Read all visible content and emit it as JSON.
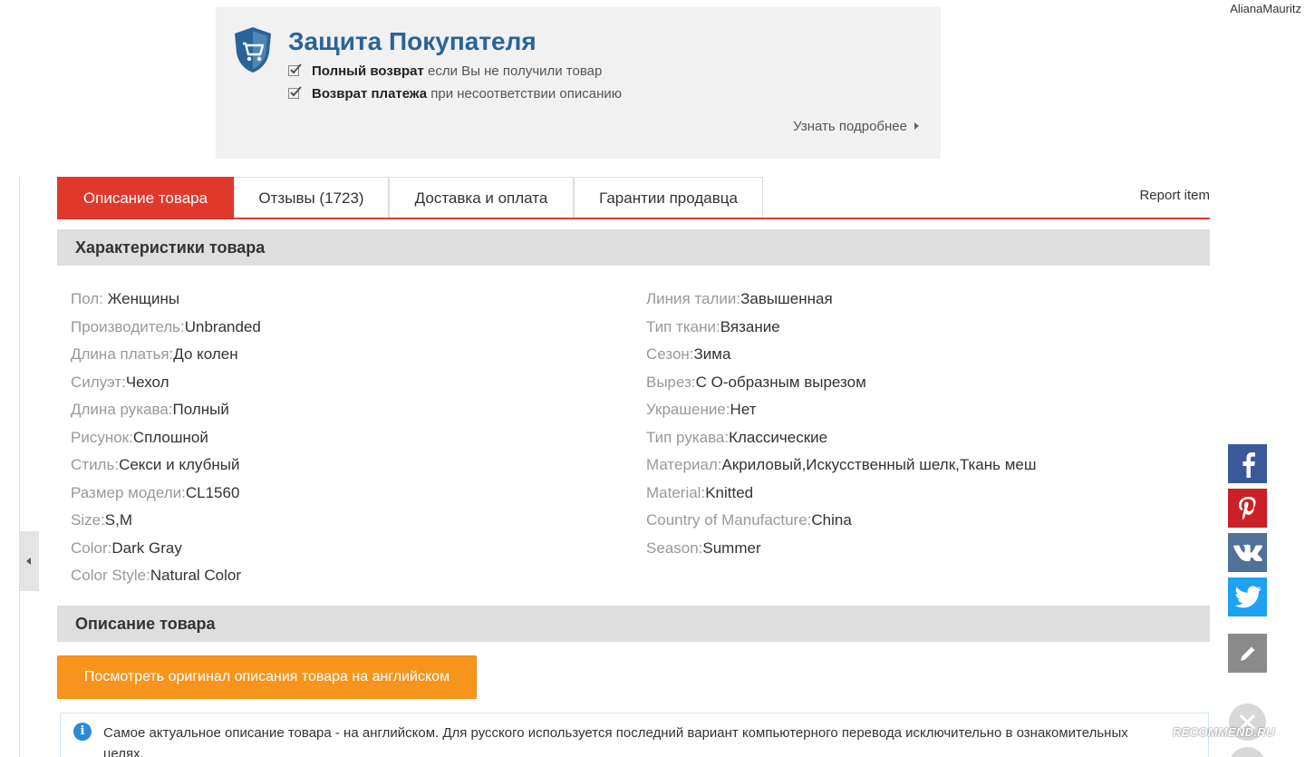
{
  "header": {
    "username": "AlianaMauritz"
  },
  "protection": {
    "title": "Защита Покупателя",
    "line1_bold": "Полный возврат",
    "line1_rest": " если Вы не получили товар",
    "line2_bold": "Возврат платежа",
    "line2_rest": " при несоответствии описанию",
    "more": "Узнать подробнее",
    "accent_color": "#2a6497"
  },
  "tabs": [
    {
      "label": "Описание товара",
      "active": true
    },
    {
      "label": "Отзывы (1723)"
    },
    {
      "label": "Доставка и оплата"
    },
    {
      "label": "Гарантии продавца"
    }
  ],
  "report": "Report item",
  "specs": {
    "title": "Характеристики товара",
    "left": [
      {
        "k": "Пол: ",
        "v": "Женщины"
      },
      {
        "k": "Производитель:",
        "v": "Unbranded"
      },
      {
        "k": "Длина платья:",
        "v": "До колен"
      },
      {
        "k": "Силуэт:",
        "v": "Чехол"
      },
      {
        "k": "Длина рукава:",
        "v": "Полный"
      },
      {
        "k": "Рисунок:",
        "v": "Сплошной"
      },
      {
        "k": "Стиль:",
        "v": "Секси и клубный"
      },
      {
        "k": "Размер модели:",
        "v": "CL1560"
      },
      {
        "k": "Size:",
        "v": "S,M"
      },
      {
        "k": "Color:",
        "v": "Dark Gray"
      },
      {
        "k": "Color Style:",
        "v": "Natural Color"
      }
    ],
    "right": [
      {
        "k": "Линия талии:",
        "v": "Завышенная"
      },
      {
        "k": "Тип ткани:",
        "v": "Вязание"
      },
      {
        "k": "Сезон:",
        "v": "Зима"
      },
      {
        "k": "Вырез:",
        "v": "С О-образным вырезом"
      },
      {
        "k": "Украшение:",
        "v": "Нет"
      },
      {
        "k": "Тип рукава:",
        "v": "Классические"
      },
      {
        "k": "Материал:",
        "v": "Акриловый,Искусственный шелк,Ткань меш"
      },
      {
        "k": "Material:",
        "v": "Knitted"
      },
      {
        "k": "Country of Manufacture:",
        "v": "China"
      },
      {
        "k": "Season:",
        "v": "Summer"
      }
    ]
  },
  "description": {
    "title": "Описание товара",
    "button": "Посмотреть оригинал описания товара на английском",
    "info": "Самое актуальное описание товара - на английском. Для русского используется последний вариант компьютерного перевода исключительно в ознакомительных целях."
  },
  "social": {
    "icons": [
      "facebook-icon",
      "pinterest-icon",
      "vk-icon",
      "twitter-icon",
      "pencil-icon"
    ],
    "colors": {
      "facebook": "#3b5998",
      "pinterest": "#cb2027",
      "vk": "#507299",
      "twitter": "#1da1f2"
    }
  },
  "watermark": "RECOMMEND.RU",
  "colors": {
    "active_tab": "#e0392b",
    "orange_button": "#f7941d"
  }
}
